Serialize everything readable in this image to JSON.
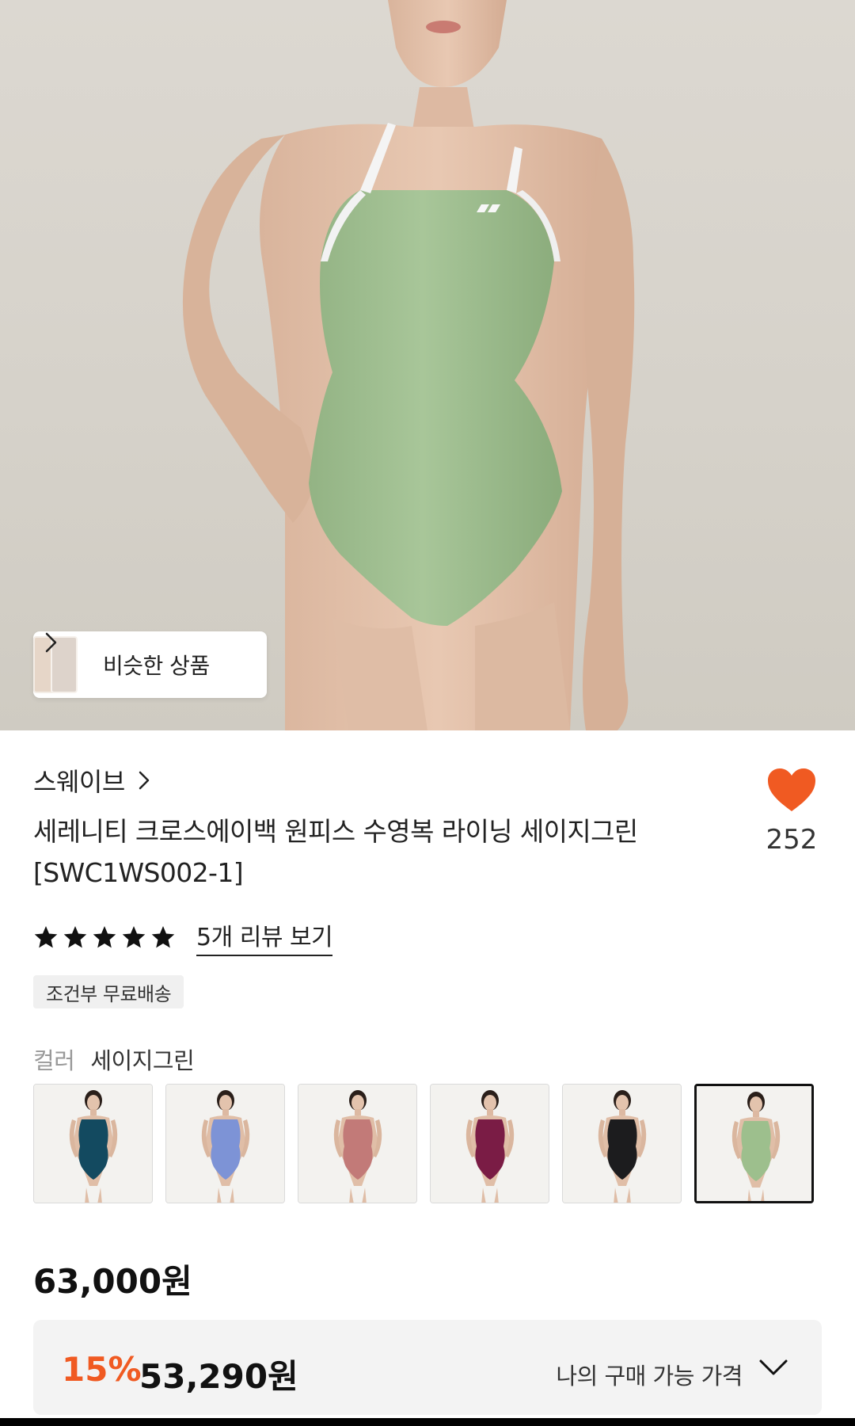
{
  "hero": {
    "similar_button_label": "비슷한 상품"
  },
  "product": {
    "brand": "스웨이브",
    "title": "세레니티 크로스에이백 원피스 수영복 라이닝 세이지그린 [SWC1WS002-1]",
    "like_count": "252",
    "rating_stars": 5,
    "review_link": "5개 리뷰 보기",
    "shipping_badge": "조건부 무료배송",
    "color_label": "컬러",
    "color_value": "세이지그린"
  },
  "swatches": [
    {
      "name": "swatch-teal",
      "color": "#134a60"
    },
    {
      "name": "swatch-periwinkle",
      "color": "#7d93d6"
    },
    {
      "name": "swatch-dusty-rose",
      "color": "#c27a78"
    },
    {
      "name": "swatch-burgundy",
      "color": "#7a1c45"
    },
    {
      "name": "swatch-black",
      "color": "#1c1c1e"
    },
    {
      "name": "swatch-sage-green",
      "color": "#9dbf8d",
      "selected": true
    }
  ],
  "price": {
    "original": "63,000원",
    "discount": "15%",
    "sale": "53,290원",
    "my_price_label": "나의 구매 가능 가격"
  },
  "colors": {
    "accent_orange": "#f05a22",
    "heart": "#f05a22"
  }
}
